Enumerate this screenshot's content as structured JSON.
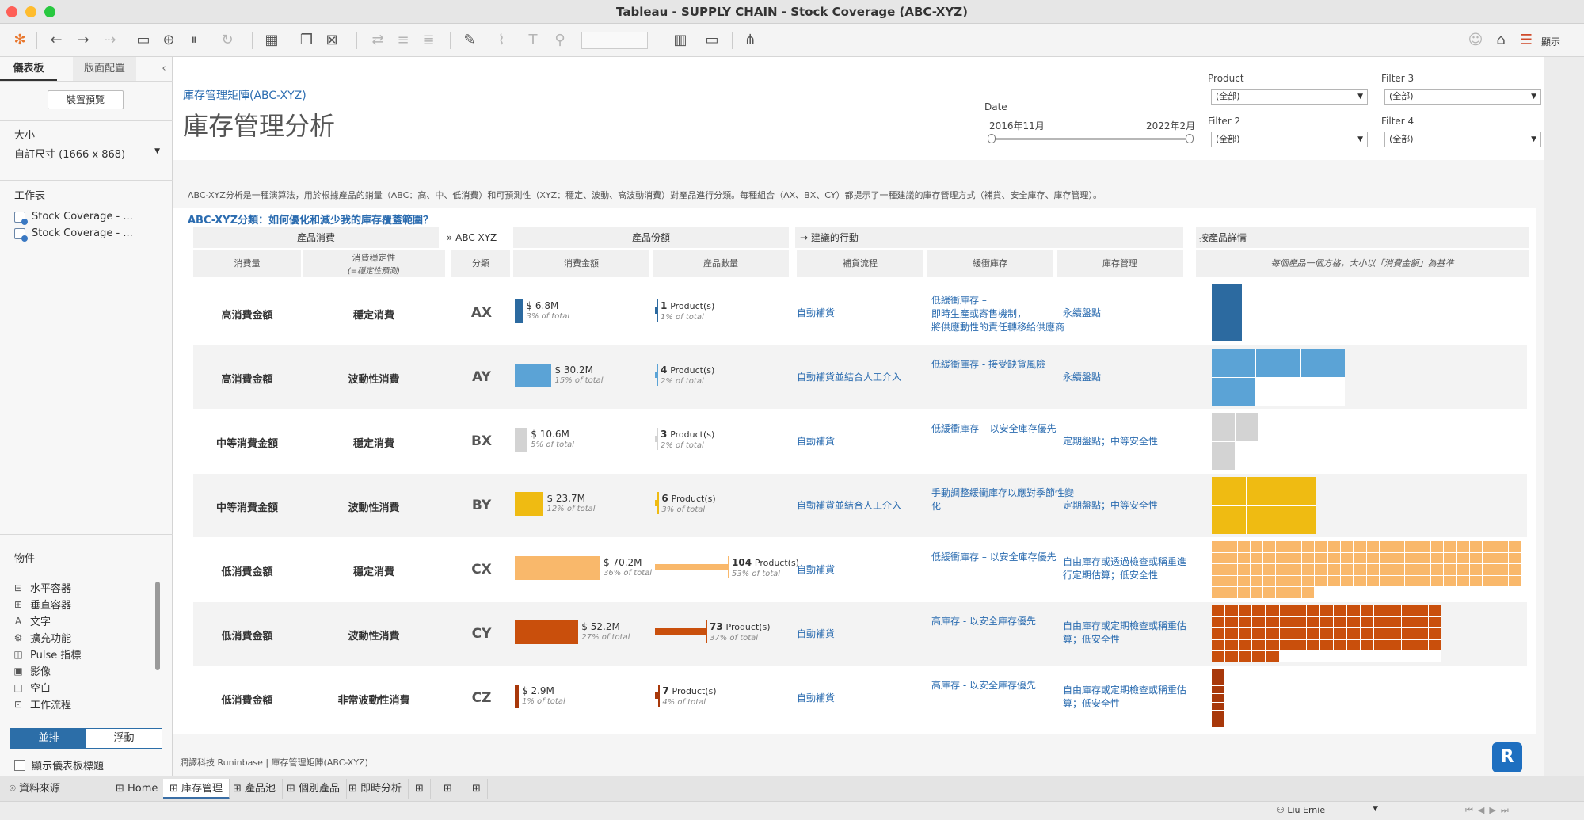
{
  "window": {
    "title": "Tableau - SUPPLY CHAIN - Stock Coverage (ABC-XYZ)"
  },
  "toolbar": {
    "show_me_label": "顯示"
  },
  "left_panel": {
    "tabs": [
      "儀表板",
      "版面配置"
    ],
    "device_preview": "裝置預覽",
    "size_label": "大小",
    "size_value": "自訂尺寸 (1666 x 868)",
    "sheets_label": "工作表",
    "sheets": [
      "Stock Coverage - ...",
      "Stock Coverage - ..."
    ],
    "objects_label": "物件",
    "objects": [
      {
        "icon": "horizontal-container-icon",
        "label": "水平容器"
      },
      {
        "icon": "vertical-container-icon",
        "label": "垂直容器"
      },
      {
        "icon": "text-icon",
        "label": "文字"
      },
      {
        "icon": "extension-icon",
        "label": "擴充功能"
      },
      {
        "icon": "pulse-icon",
        "label": "Pulse 指標"
      },
      {
        "icon": "image-icon",
        "label": "影像"
      },
      {
        "icon": "blank-icon",
        "label": "空白"
      },
      {
        "icon": "workflow-icon",
        "label": "工作流程"
      }
    ],
    "tiled": "並排",
    "floating": "浮動",
    "show_title": "顯示儀表板標題"
  },
  "header": {
    "subtitle": "庫存管理矩陣(ABC-XYZ)",
    "title": "庫存管理分析",
    "date_label": "Date",
    "date_start": "2016年11月",
    "date_end": "2022年2月",
    "filters": [
      {
        "label": "Product",
        "value": "(全部)"
      },
      {
        "label": "Filter 3",
        "value": "(全部)"
      },
      {
        "label": "Filter 2",
        "value": "(全部)"
      },
      {
        "label": "Filter 4",
        "value": "(全部)"
      }
    ]
  },
  "description": "ABC-XYZ分析是一種演算法，用於根據產品的銷量（ABC：高、中、低消費）和可預測性（XYZ：穩定、波動、高波動消費）對產品進行分類。每種組合（AX、BX、CY）都提示了一種建議的庫存管理方式（補貨、安全庫存、庫存管理）。",
  "question": "ABC-XYZ分類：如何優化和減少我的庫存覆蓋範圍？",
  "table": {
    "groups": {
      "consumption": "產品消費",
      "abc": "ABC-XYZ",
      "share": "產品份額",
      "actions": "建議的行動",
      "detail": "按產品詳情"
    },
    "subheaders": {
      "volume": "消費量",
      "stability": "消費穩定性",
      "stability_note": "(=穩定性預測)",
      "class": "分類",
      "amount": "消費金額",
      "count": "產品數量",
      "replenish": "補貨流程",
      "buffer": "緩衝庫存",
      "stock_mgmt": "庫存管理",
      "detail_note": "每個產品一個方格，大小以「消費金額」為基準"
    },
    "rows": [
      {
        "volume": "高消費金額",
        "stability": "穩定消費",
        "code": "AX",
        "amount": "$ 6.8M",
        "amount_pct": "3% of total",
        "count": "1",
        "count_pct": "1% of total",
        "replenish": "自動補貨",
        "buffer": "低緩衝庫存 –\n即時生產或寄售機制，\n將供應動性的責任轉移給供應商",
        "stock": "永續盤點",
        "color": "#2c6aa0",
        "amount_value": 6.8,
        "count_value": 1
      },
      {
        "volume": "高消費金額",
        "stability": "波動性消費",
        "code": "AY",
        "amount": "$ 30.2M",
        "amount_pct": "15% of total",
        "count": "4",
        "count_pct": "2% of total",
        "replenish": "自動補貨並結合人工介入",
        "buffer": "低緩衝庫存 - 接受缺貨風險",
        "stock": "永續盤點",
        "color": "#5ba3d6",
        "amount_value": 30.2,
        "count_value": 4
      },
      {
        "volume": "中等消費金額",
        "stability": "穩定消費",
        "code": "BX",
        "amount": "$ 10.6M",
        "amount_pct": "5% of total",
        "count": "3",
        "count_pct": "2% of total",
        "replenish": "自動補貨",
        "buffer": "低緩衝庫存 – 以安全庫存優先",
        "stock": "定期盤點；中等安全性",
        "color": "#d3d3d3",
        "amount_value": 10.6,
        "count_value": 3
      },
      {
        "volume": "中等消費金額",
        "stability": "波動性消費",
        "code": "BY",
        "amount": "$ 23.7M",
        "amount_pct": "12% of total",
        "count": "6",
        "count_pct": "3% of total",
        "replenish": "自動補貨並結合人工介入",
        "buffer": "手動調整緩衝庫存以應對季節性變化",
        "stock": "定期盤點；中等安全性",
        "color": "#efbb12",
        "amount_value": 23.7,
        "count_value": 6
      },
      {
        "volume": "低消費金額",
        "stability": "穩定消費",
        "code": "CX",
        "amount": "$ 70.2M",
        "amount_pct": "36% of total",
        "count": "104",
        "count_pct": "53% of total",
        "replenish": "自動補貨",
        "buffer": "低緩衝庫存 – 以安全庫存優先",
        "stock": "自由庫存或透過檢查或稱重進行定期估算；低安全性",
        "color": "#f9b86b",
        "amount_value": 70.2,
        "count_value": 104
      },
      {
        "volume": "低消費金額",
        "stability": "波動性消費",
        "code": "CY",
        "amount": "$ 52.2M",
        "amount_pct": "27% of total",
        "count": "73",
        "count_pct": "37% of total",
        "replenish": "自動補貨",
        "buffer": "高庫存 - 以安全庫存優先",
        "stock": "自由庫存或定期檢查或稱重估算；低安全性",
        "color": "#c94f0c",
        "amount_value": 52.2,
        "count_value": 73
      },
      {
        "volume": "低消費金額",
        "stability": "非常波動性消費",
        "code": "CZ",
        "amount": "$ 2.9M",
        "amount_pct": "1% of total",
        "count": "7",
        "count_pct": "4% of total",
        "replenish": "自動補貨",
        "buffer": "高庫存 - 以安全庫存優先",
        "stock": "自由庫存或定期檢查或稱重估算；低安全性",
        "color": "#a8380a",
        "amount_value": 2.9,
        "count_value": 7
      }
    ],
    "product_suffix": "Product(s)"
  },
  "footer": "潤譯科技 Runinbase | 庫存管理矩陣(ABC-XYZ)",
  "sheet_tabs": {
    "data_source": "資料來源",
    "tabs": [
      "Home",
      "庫存管理",
      "產品池",
      "個別產品",
      "即時分析"
    ],
    "active": 1
  },
  "status": {
    "user": "Liu Ernie"
  }
}
